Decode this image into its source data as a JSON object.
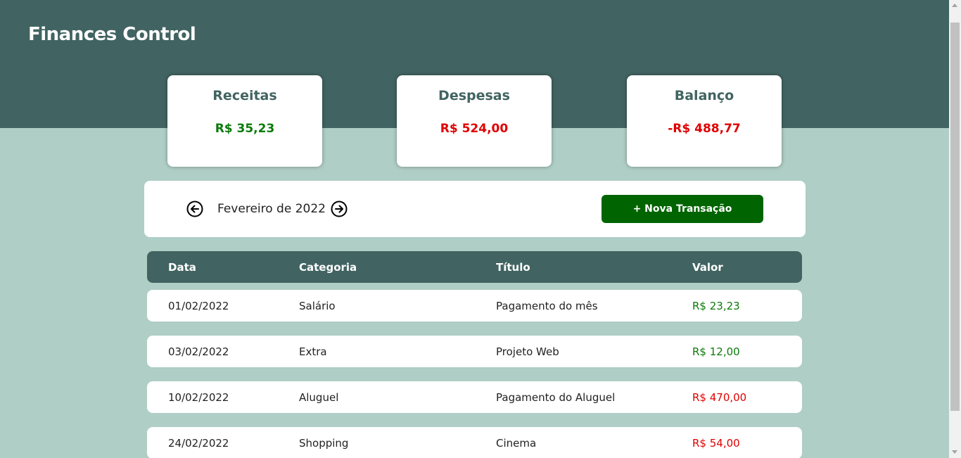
{
  "header": {
    "title": "Finances Control"
  },
  "summary": {
    "income": {
      "title": "Receitas",
      "value": "R$ 35,23"
    },
    "expenses": {
      "title": "Despesas",
      "value": "R$ 524,00"
    },
    "balance": {
      "title": "Balanço",
      "value": "-R$ 488,77"
    }
  },
  "month_bar": {
    "month": "Fevereiro de 2022",
    "prev_icon": "arrow-left-circle-icon",
    "next_icon": "arrow-right-circle-icon",
    "new_button": "+ Nova Transação"
  },
  "table": {
    "columns": [
      "Data",
      "Categoria",
      "Título",
      "Valor"
    ],
    "rows": [
      {
        "date": "01/02/2022",
        "category": "Salário",
        "title": "Pagamento do mês",
        "value": "R$ 23,23",
        "type": "income"
      },
      {
        "date": "03/02/2022",
        "category": "Extra",
        "title": "Projeto Web",
        "value": "R$ 12,00",
        "type": "income"
      },
      {
        "date": "10/02/2022",
        "category": "Aluguel",
        "title": "Pagamento do Aluguel",
        "value": "R$ 470,00",
        "type": "expense"
      },
      {
        "date": "24/02/2022",
        "category": "Shopping",
        "title": "Cinema",
        "value": "R$ 54,00",
        "type": "expense"
      }
    ]
  },
  "colors": {
    "header": "#416462",
    "background": "#afcec5",
    "income": "#0a7a0a",
    "expense": "#e00000",
    "button": "#006400"
  }
}
